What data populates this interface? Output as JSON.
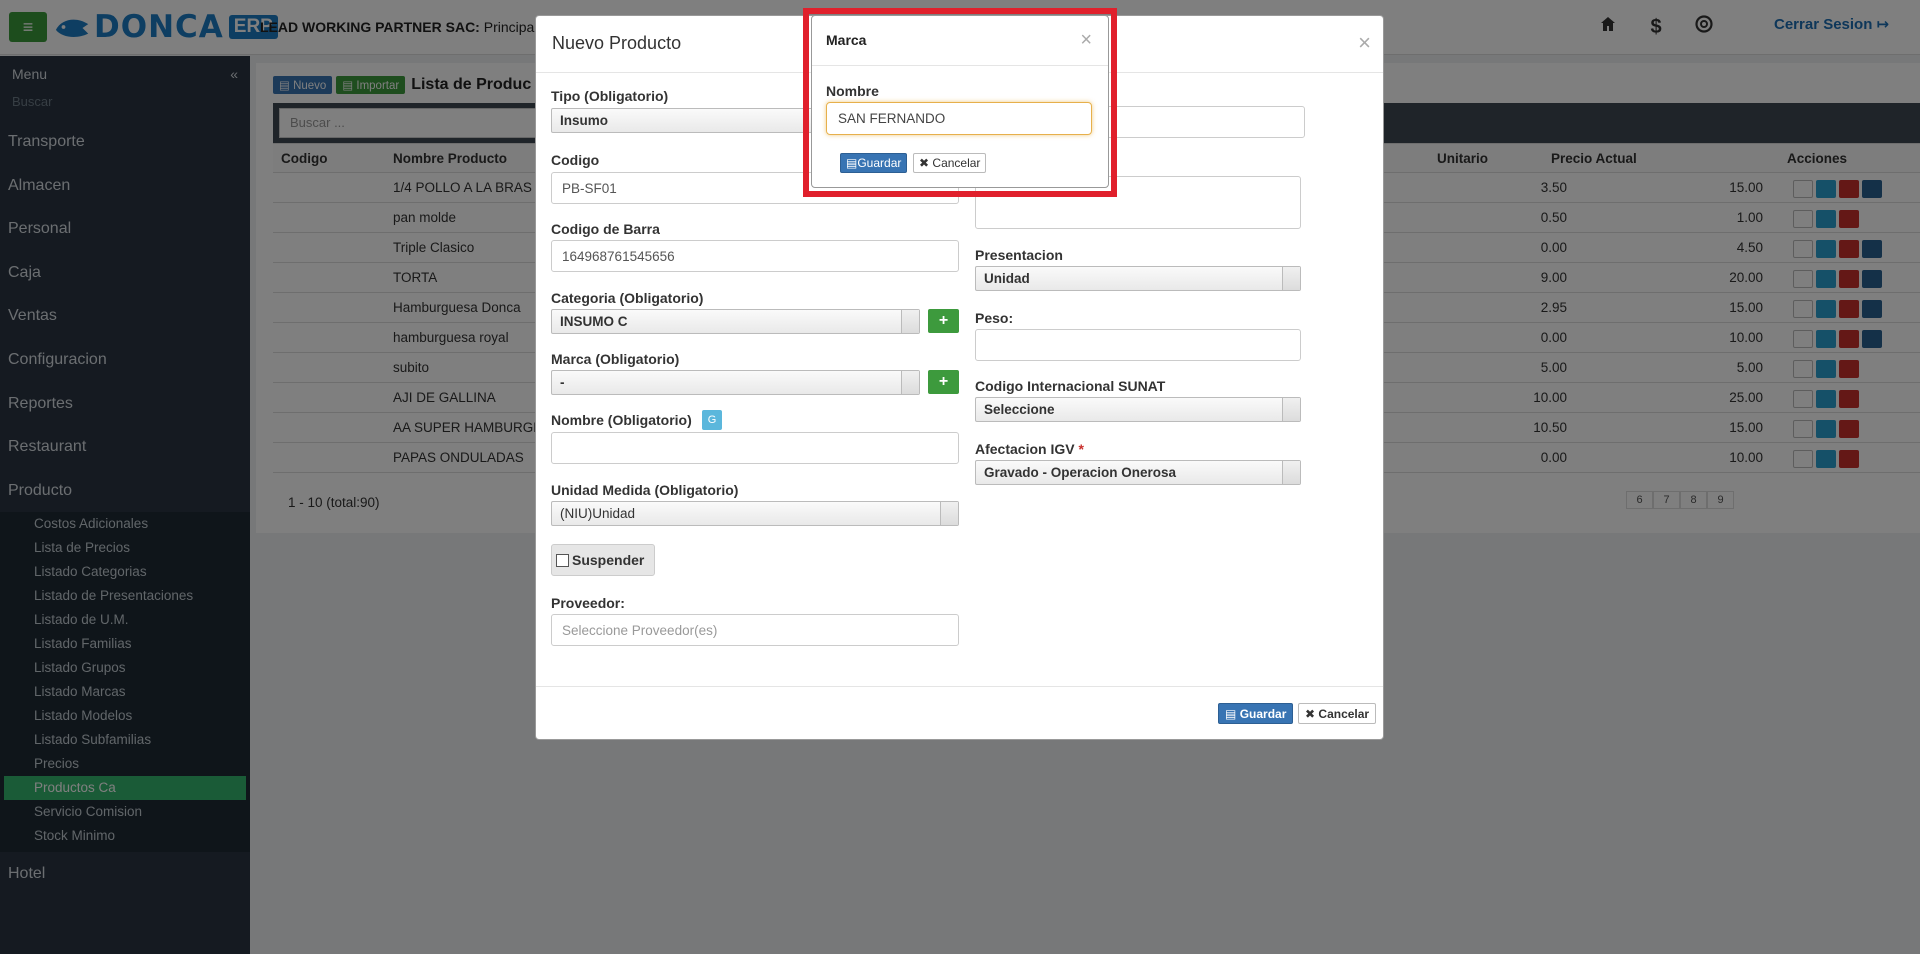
{
  "header": {
    "menu_icon": "menu-icon",
    "logo_text": "DONCA",
    "logo_badge": "ERP",
    "company_name": "LEAD WORKING PARTNER SAC:",
    "company_branch": "Principal",
    "icons": [
      "home-icon",
      "dollar-icon",
      "support-icon"
    ],
    "logout_label": "Cerrar Sesion"
  },
  "sidebar": {
    "title": "Menu",
    "collapse_glyph": "«",
    "search_placeholder": "Buscar",
    "items": [
      "Transporte",
      "Almacen",
      "Personal",
      "Caja",
      "Ventas",
      "Configuracion",
      "Reportes",
      "Restaurant",
      "Producto"
    ],
    "sub_items": [
      "Costos Adicionales",
      "Lista de Precios",
      "Listado Categorias",
      "Listado de Presentaciones",
      "Listado de U.M.",
      "Listado Familias",
      "Listado Grupos",
      "Listado Marcas",
      "Listado Modelos",
      "Listado Subfamilias",
      "Precios",
      "Productos Ca",
      "Servicio Comision",
      "Stock Minimo"
    ],
    "active_sub": "Productos Ca",
    "bottom_item": "Hotel"
  },
  "main": {
    "new_label": "Nuevo",
    "import_label": "Importar",
    "title": "Lista de Produc",
    "search_placeholder": "Buscar ...",
    "columns": {
      "code": "Codigo",
      "name": "Nombre Producto",
      "unit": "Unitario",
      "price": "Precio Actual",
      "actions": "Acciones"
    },
    "rows": [
      {
        "name": "1/4 POLLO A LA BRAS",
        "unit": "3.50",
        "price": "15.00",
        "gear": true
      },
      {
        "name": "pan molde",
        "unit": "0.50",
        "price": "1.00",
        "gear": false
      },
      {
        "name": "Triple Clasico",
        "unit": "0.00",
        "price": "4.50",
        "gear": true
      },
      {
        "name": "TORTA",
        "unit": "9.00",
        "price": "20.00",
        "gear": true
      },
      {
        "name": "Hamburguesa Donca",
        "unit": "2.95",
        "price": "15.00",
        "gear": true
      },
      {
        "name": "hamburguesa royal",
        "unit": "0.00",
        "price": "10.00",
        "gear": true
      },
      {
        "name": "subito",
        "unit": "5.00",
        "price": "5.00",
        "gear": false
      },
      {
        "name": "AJI DE GALLINA",
        "unit": "10.00",
        "price": "25.00",
        "gear": false
      },
      {
        "name": "AA SUPER HAMBURGE",
        "unit": "10.50",
        "price": "15.00",
        "gear": false
      },
      {
        "name": "PAPAS ONDULADAS",
        "unit": "0.00",
        "price": "10.00",
        "gear": false
      }
    ],
    "pager_text": "1 - 10 (total:90)",
    "pages": [
      "6",
      "7",
      "8",
      "9"
    ]
  },
  "producto_modal": {
    "title": "Nuevo Producto",
    "close": "×",
    "tipo_label": "Tipo (Obligatorio)",
    "tipo_value": "Insumo",
    "codigo_label": "Codigo",
    "codigo_value": "PB-SF01",
    "barra_label": "Codigo de Barra",
    "barra_value": "164968761545656",
    "categoria_label": "Categoria (Obligatorio)",
    "categoria_value": "INSUMO C",
    "marca_label": "Marca (Obligatorio)",
    "marca_value": "-",
    "nombre_label": "Nombre (Obligatorio)",
    "nombre_badge": "G",
    "unidad_label": "Unidad Medida (Obligatorio)",
    "unidad_value": "(NIU)Unidad",
    "suspender_label": "Suspender",
    "proveedor_label": "Proveedor:",
    "proveedor_placeholder": "Seleccione Proveedor(es)",
    "presentacion_label": "Presentacion",
    "presentacion_value": "Unidad",
    "peso_label": "Peso:",
    "sunat_label": "Codigo Internacional SUNAT",
    "sunat_value": "Seleccione",
    "igv_label": "Afectacion IGV",
    "igv_required": "*",
    "igv_value": "Gravado - Operacion Onerosa",
    "save_label": "Guardar",
    "cancel_label": "Cancelar"
  },
  "marca_modal": {
    "title": "Marca",
    "close": "×",
    "nombre_label": "Nombre",
    "nombre_value": "SAN FERNANDO",
    "save_label": "Guardar",
    "cancel_label": "Cancelar"
  },
  "colors": {
    "accent": "#3b9b3b",
    "brand": "#1d7cc4",
    "highlight": "#e0202c",
    "primary": "#3874b3"
  }
}
